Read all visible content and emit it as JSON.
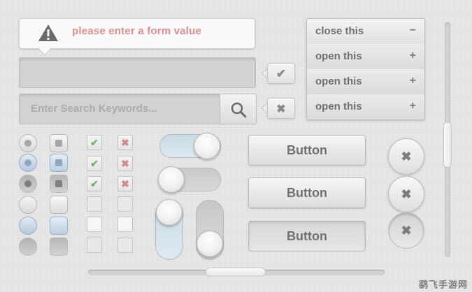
{
  "tooltip": {
    "text": "please enter a form value",
    "icon": "warning-icon"
  },
  "search": {
    "placeholder": "Enter Search Keywords...",
    "icon": "search-icon"
  },
  "validation": {
    "valid_icon": "check-icon",
    "invalid_icon": "close-icon",
    "valid_glyph": "✔",
    "invalid_glyph": "✖"
  },
  "accordion": {
    "items": [
      {
        "label": "close this",
        "sign": "−",
        "state": "open"
      },
      {
        "label": "open this",
        "sign": "+",
        "state": "closed"
      },
      {
        "label": "open this",
        "sign": "+",
        "state": "closed"
      },
      {
        "label": "open this",
        "sign": "+",
        "state": "closed"
      }
    ]
  },
  "checkboxes": {
    "check_glyph": "✔",
    "cross_glyph": "✖"
  },
  "buttons": {
    "labels": [
      "Button",
      "Button",
      "Button"
    ],
    "close_glyph": "✖"
  },
  "colors": {
    "tooltip_text": "#e28b8b",
    "check_green": "#6fb36f",
    "cross_red": "#d08a8a",
    "toggle_on": "#c9dbe5"
  },
  "watermark": "鹞飞手游网"
}
